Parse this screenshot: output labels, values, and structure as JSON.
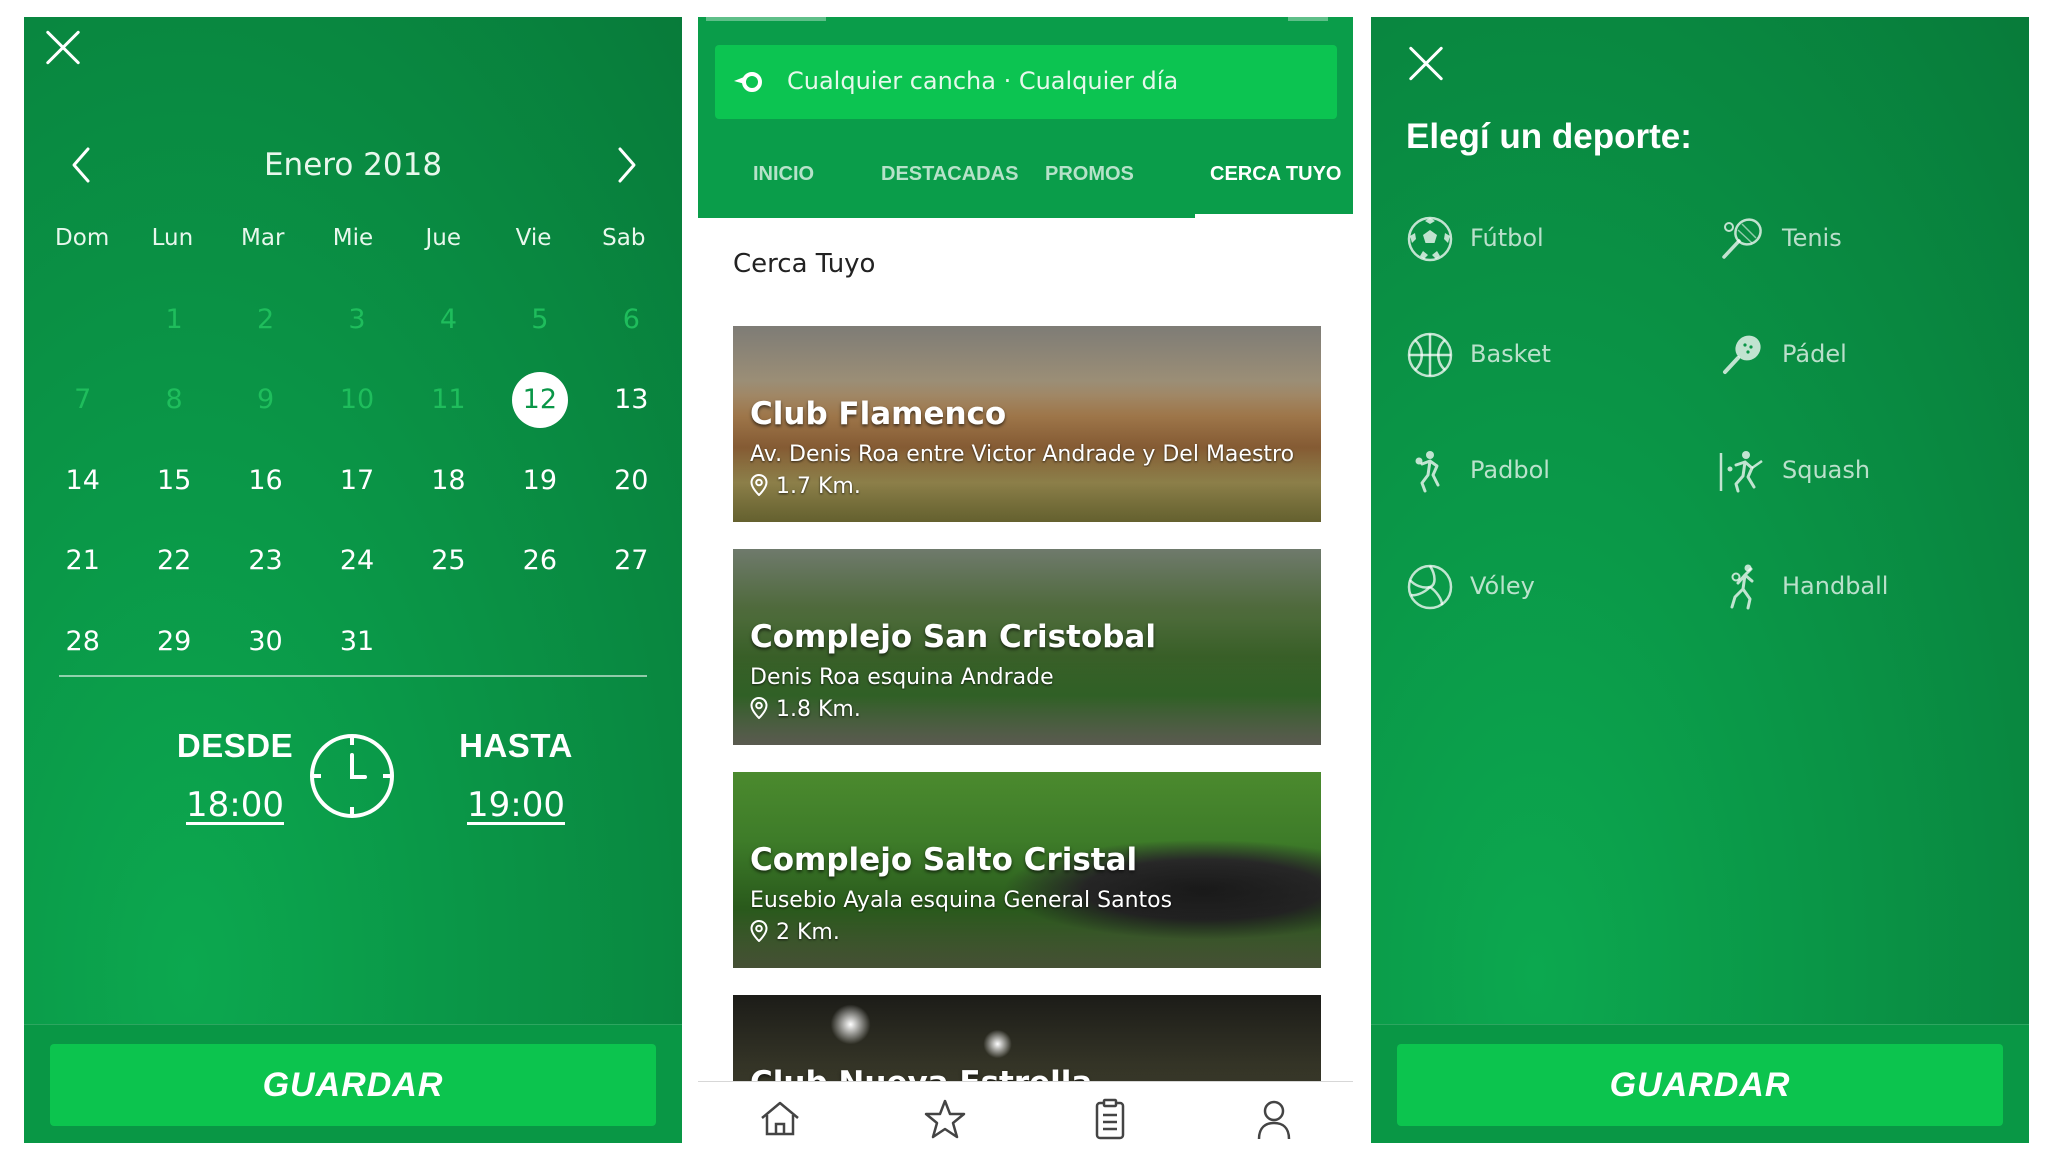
{
  "calendar_screen": {
    "month_title": "Enero 2018",
    "weekdays": [
      "Dom",
      "Lun",
      "Mar",
      "Mie",
      "Jue",
      "Vie",
      "Sab"
    ],
    "days": [
      {
        "label": "",
        "state": "empty"
      },
      {
        "label": "1",
        "state": "past"
      },
      {
        "label": "2",
        "state": "past"
      },
      {
        "label": "3",
        "state": "past"
      },
      {
        "label": "4",
        "state": "past"
      },
      {
        "label": "5",
        "state": "past"
      },
      {
        "label": "6",
        "state": "past"
      },
      {
        "label": "7",
        "state": "past"
      },
      {
        "label": "8",
        "state": "past"
      },
      {
        "label": "9",
        "state": "past"
      },
      {
        "label": "10",
        "state": "past"
      },
      {
        "label": "11",
        "state": "past"
      },
      {
        "label": "12",
        "state": "selected"
      },
      {
        "label": "13",
        "state": "normal"
      },
      {
        "label": "14",
        "state": "normal"
      },
      {
        "label": "15",
        "state": "normal"
      },
      {
        "label": "16",
        "state": "normal"
      },
      {
        "label": "17",
        "state": "normal"
      },
      {
        "label": "18",
        "state": "normal"
      },
      {
        "label": "19",
        "state": "normal"
      },
      {
        "label": "20",
        "state": "normal"
      },
      {
        "label": "21",
        "state": "normal"
      },
      {
        "label": "22",
        "state": "normal"
      },
      {
        "label": "23",
        "state": "normal"
      },
      {
        "label": "24",
        "state": "normal"
      },
      {
        "label": "25",
        "state": "normal"
      },
      {
        "label": "26",
        "state": "normal"
      },
      {
        "label": "27",
        "state": "normal"
      },
      {
        "label": "28",
        "state": "normal"
      },
      {
        "label": "29",
        "state": "normal"
      },
      {
        "label": "30",
        "state": "normal"
      },
      {
        "label": "31",
        "state": "normal"
      }
    ],
    "from_label": "DESDE",
    "from_time": "18:00",
    "to_label": "HASTA",
    "to_time": "19:00",
    "save_label": "GUARDAR",
    "icons": {
      "close": "close-icon",
      "prev": "chevron-left-icon",
      "next": "chevron-right-icon",
      "clock": "clock-icon"
    }
  },
  "list_screen": {
    "search_text": "Cualquier cancha · Cualquier día",
    "tabs": [
      {
        "label": "INICIO",
        "active": false
      },
      {
        "label": "DESTACADAS",
        "active": false
      },
      {
        "label": "PROMOS",
        "active": false
      },
      {
        "label": "CERCA TUYO",
        "active": true
      }
    ],
    "section_title": "Cerca Tuyo",
    "venues": [
      {
        "name": "Club Flamenco",
        "address": "Av. Denis Roa entre Victor Andrade y Del Maestro",
        "distance": "1.7 Km."
      },
      {
        "name": "Complejo San Cristobal",
        "address": "Denis Roa esquina Andrade",
        "distance": "1.8 Km."
      },
      {
        "name": "Complejo Salto Cristal",
        "address": "Eusebio Ayala esquina General Santos",
        "distance": "2 Km."
      },
      {
        "name": "Club Nueva Estrella",
        "address": "",
        "distance": ""
      }
    ],
    "bottom_nav": [
      "home-icon",
      "star-icon",
      "clipboard-icon",
      "user-icon"
    ]
  },
  "sports_screen": {
    "title": "Elegí un deporte:",
    "sports": [
      {
        "label": "Fútbol",
        "icon": "soccer-ball-icon"
      },
      {
        "label": "Tenis",
        "icon": "tennis-racket-icon"
      },
      {
        "label": "Basket",
        "icon": "basketball-icon"
      },
      {
        "label": "Pádel",
        "icon": "padel-racket-icon"
      },
      {
        "label": "Padbol",
        "icon": "padbol-player-icon"
      },
      {
        "label": "Squash",
        "icon": "squash-player-icon"
      },
      {
        "label": "Vóley",
        "icon": "volleyball-icon"
      },
      {
        "label": "Handball",
        "icon": "handball-player-icon"
      }
    ],
    "save_label": "GUARDAR"
  },
  "colors": {
    "brand_green": "#0a9647",
    "button_green": "#0cc44e",
    "white": "#ffffff"
  }
}
